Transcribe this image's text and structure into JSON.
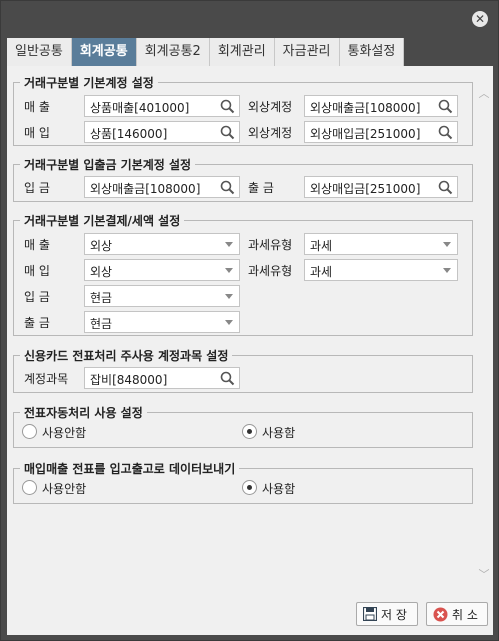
{
  "tabs": [
    "일반공통",
    "회계공통",
    "회계공통2",
    "회계관리",
    "자금관리",
    "통화설정"
  ],
  "section1": {
    "title": "거래구분별 기본계정 설정",
    "sales_label": "매 출",
    "sales_value": "상품매출[401000]",
    "sales_credit_label": "외상계정",
    "sales_credit_value": "외상매출금[108000]",
    "purchase_label": "매 입",
    "purchase_value": "상품[146000]",
    "purchase_credit_label": "외상계정",
    "purchase_credit_value": "외상매입금[251000]"
  },
  "section2": {
    "title": "거래구분별 입출금 기본계정 설정",
    "in_label": "입 금",
    "in_value": "외상매출금[108000]",
    "out_label": "출 금",
    "out_value": "외상매입금[251000]"
  },
  "section3": {
    "title": "거래구분별 기본결제/세액 설정",
    "sales_label": "매 출",
    "sales_value": "외상",
    "sales_tax_label": "과세유형",
    "sales_tax_value": "과세",
    "purchase_label": "매 입",
    "purchase_value": "외상",
    "purchase_tax_label": "과세유형",
    "purchase_tax_value": "과세",
    "in_label": "입 금",
    "in_value": "현금",
    "out_label": "출 금",
    "out_value": "현금"
  },
  "section4": {
    "title": "신용카드 전표처리 주사용 계정과목 설정",
    "account_label": "계정과목",
    "account_value": "잡비[848000]"
  },
  "section5": {
    "title": "전표자동처리 사용 설정",
    "option_off": "사용안함",
    "option_on": "사용함",
    "selected": "사용함"
  },
  "section6": {
    "title": "매입매출 전표를 입고출고로 데이터보내기",
    "option_off": "사용안함",
    "option_on": "사용함",
    "selected": "사용함"
  },
  "buttons": {
    "save": "저 장",
    "cancel": "취 소"
  },
  "icons": [
    "close-icon",
    "search-icon",
    "dropdown-arrow-icon",
    "save-icon",
    "cancel-icon",
    "scroll-up-icon",
    "scroll-down-icon"
  ],
  "colors": {
    "active_tab": "#5a7d9a",
    "frame": "#4a4a4a",
    "panel": "#f0f0f0",
    "cancel_icon": "#d9534f"
  }
}
